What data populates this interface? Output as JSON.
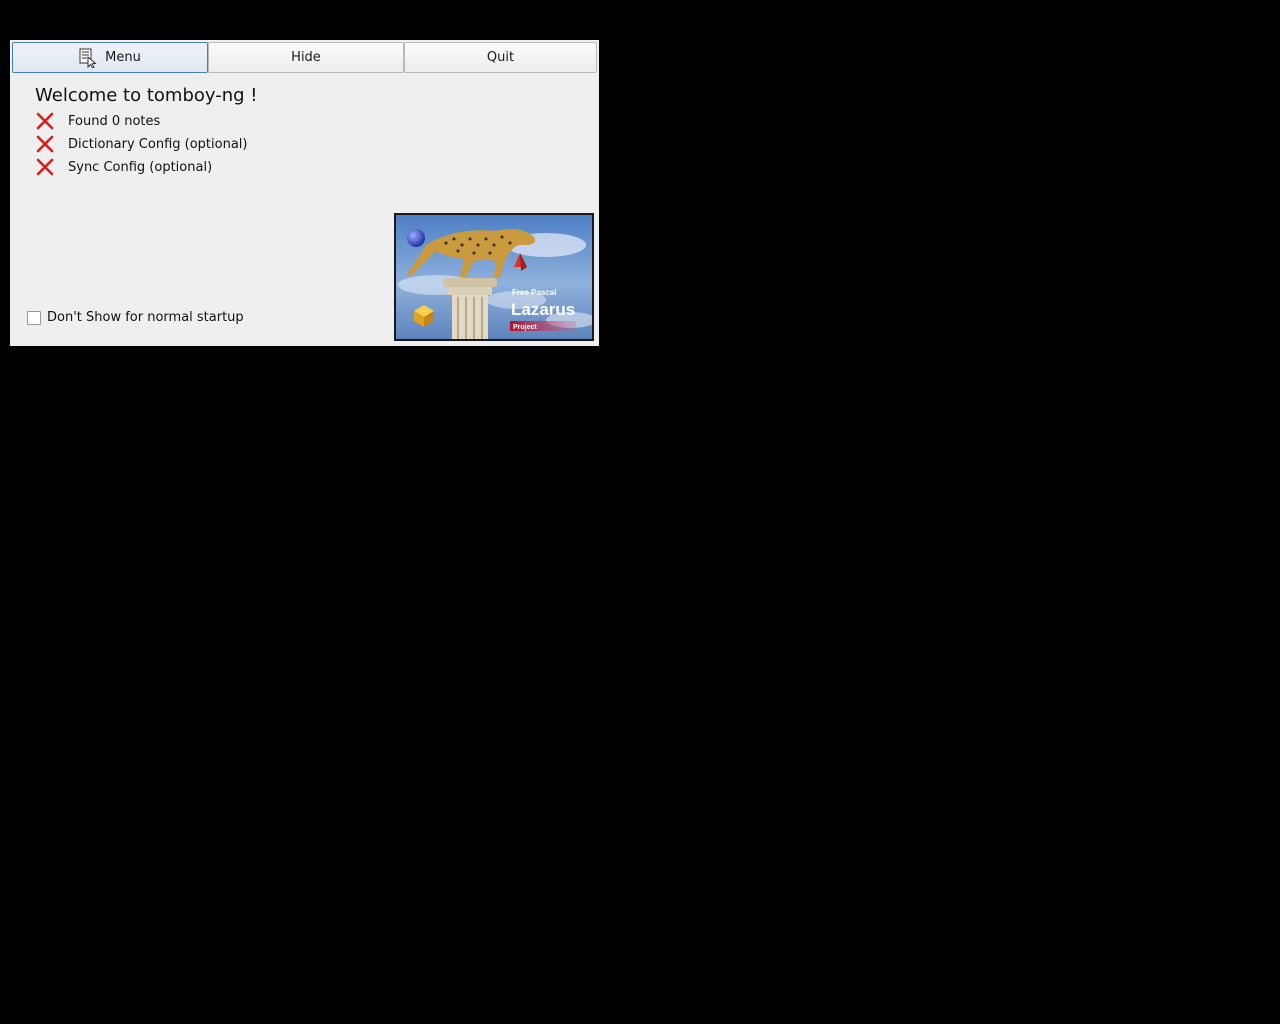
{
  "toolbar": {
    "menu_label": "Menu",
    "menu_icon": "notes-icon",
    "hide_label": "Hide",
    "quit_label": "Quit"
  },
  "welcome": {
    "title": "Welcome to tomboy-ng !"
  },
  "status_items": [
    {
      "label": "Found 0 notes",
      "icon": "fail-x-icon",
      "state": "error"
    },
    {
      "label": "Dictionary Config (optional)",
      "icon": "fail-x-icon",
      "state": "error"
    },
    {
      "label": "Sync Config (optional)",
      "icon": "fail-x-icon",
      "state": "error"
    }
  ],
  "startup": {
    "checkbox_label": "Don't Show for normal startup",
    "checked": false
  },
  "logo": {
    "text_top": "Free Pascal",
    "text_main": "Lazarus",
    "text_sub": "Project"
  },
  "colors": {
    "error_red": "#d81e1e",
    "window_bg": "#efefef",
    "active_border": "#4a7db8"
  }
}
